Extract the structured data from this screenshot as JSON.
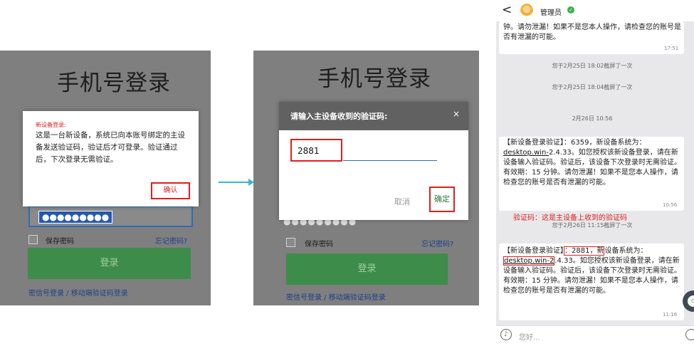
{
  "panel1": {
    "title": "手机号登录",
    "alert_heading": "新设备登录:",
    "alert_body": "这是一台新设备，系统已向本账号绑定的主设备发送验证码，验证后才可登录。验证通过后，下次登录无需验证。",
    "ok_button": "确认",
    "password_mask": "●●●●●●●●●",
    "save_password": "保存密码",
    "forgot_password": "忘记密码?",
    "login_button": "登录",
    "bottom_links": "密信号登录 / 移动端验证码登录"
  },
  "panel2": {
    "title": "手机号登录",
    "dialog_title": "请输入主设备收到的验证码:",
    "close_glyph": "×",
    "code_value": "2881",
    "cancel_button": "取消",
    "confirm_button": "确定",
    "password_mask": "●●●●●●●●●",
    "save_password": "保存密码",
    "forgot_password": "忘记密码?",
    "login_button": "登录",
    "bottom_links": "密信号登录 / 移动端验证码登录"
  },
  "chat": {
    "back_glyph": "<",
    "contact_name": "管理员",
    "msg0_text": "钟。请勿泄漏！如果不是您本人操作，请检查您的账号是否有泄漏的可能。",
    "msg0_time": "17:51",
    "sys1": "您于2月25日 18:02截屏了一次",
    "sys2": "您于2月25日 18:04截屏了一次",
    "date_sep": "2月26日 10:56",
    "msg1_prefix": "【新设备登录验证】：6359，新设备系统为：",
    "msg1_link": "desktop.win-",
    "msg1_rest": "2.4.33。如您授权该新设备登录，请在新设备输入验证码。验证后，该设备下次登录时无需验证。有效期：15 分钟。请勿泄漏！如果不是您本人操作，请检查您的账号是否有泄漏的可能。",
    "msg1_time": "10:56",
    "annotation": "验证码：这是主设备上收到的验证码",
    "sys3": "您于2月26日 11:15截屏了一次",
    "msg2_part1": "【新设备登录验证】",
    "msg2_part2": "：2881，新",
    "msg2_part3": "设备系统为：",
    "msg2_link": "desktop.win-2",
    "msg2_rest": ".4.33。如您授权该新设备登录，请在新设备输入验证码。验证后，该设备下次登录时无需验证。有效期：15 分钟。请勿泄漏！如果不是您本人操作，请检查您的账号是否有泄漏的可能。",
    "msg2_time": "11:16",
    "input_placeholder": "您好..."
  },
  "colors": {
    "accent_green": "#3e8c4a",
    "highlight_red": "#e02020",
    "arrow_cyan": "#38b6d6"
  }
}
